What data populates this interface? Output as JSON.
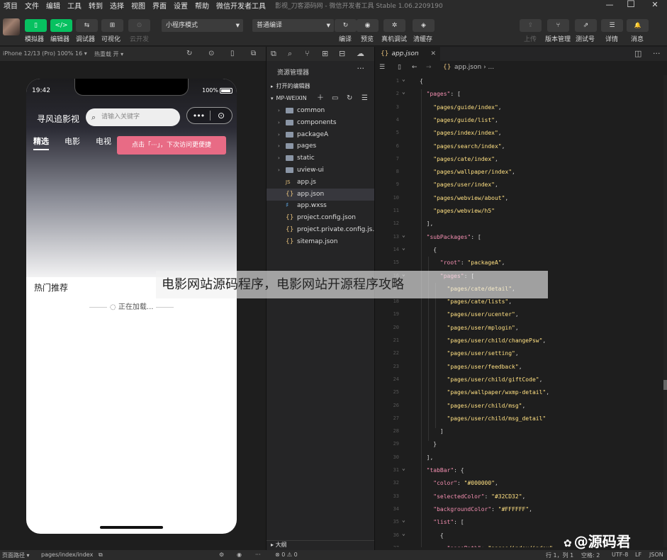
{
  "menu": {
    "items": [
      "项目",
      "文件",
      "编辑",
      "工具",
      "转到",
      "选择",
      "视图",
      "界面",
      "设置",
      "帮助",
      "微信开发者工具"
    ],
    "window_title": "影视_刀客源码网 - 微信开发者工具 Stable 1.06.2209190",
    "min": "—",
    "max": "☐",
    "close": "✕"
  },
  "toolbar": {
    "simulator": "模拟器",
    "editor": "编辑器",
    "debugger": "调试器",
    "visual": "可视化",
    "cloud": "云开发",
    "mode_select": "小程序模式",
    "compile_select": "普通编译",
    "compile": "编译",
    "preview": "预览",
    "real_debug": "真机调试",
    "clear_cache": "清缓存",
    "upload": "上传",
    "version": "版本管理",
    "test": "测试号",
    "details": "详情",
    "messages": "消息",
    "icons": {
      "simulator": "▯",
      "editor": "</>",
      "debugger": "⇆",
      "visual": "⊞",
      "cloud": "⊙",
      "compile": "↻",
      "preview": "◉",
      "real_debug": "✲",
      "clear_cache": "◈",
      "upload": "⇪",
      "version": "⑂",
      "test": "⇗",
      "details": "☰",
      "messages": "🔔"
    }
  },
  "simulator": {
    "device": "iPhone 12/13 (Pro) 100% 16 ▾",
    "hot_reload": "热重载 开 ▾",
    "status_time": "19:42",
    "battery": "100%",
    "app_name": "寻风追影视",
    "search_placeholder": "请输入关键字",
    "capsule_dots": "•••",
    "capsule_target": "⊙",
    "tabs": [
      "精选",
      "电影",
      "电视"
    ],
    "tooltip": "点击「···」，下次访问更便捷",
    "hot_title": "热门推荐",
    "loading": "正在加载..."
  },
  "explorer": {
    "title": "资源管理器",
    "more": "···",
    "open_editors": "打开的编辑器",
    "project": "MP-WEIXIN",
    "items": [
      {
        "name": "common",
        "type": "folder",
        "arrow": "›"
      },
      {
        "name": "components",
        "type": "folder",
        "arrow": "›"
      },
      {
        "name": "packageA",
        "type": "folder",
        "arrow": "›"
      },
      {
        "name": "pages",
        "type": "folder",
        "arrow": "›"
      },
      {
        "name": "static",
        "type": "folder",
        "arrow": "›"
      },
      {
        "name": "uview-ui",
        "type": "folder",
        "arrow": "›"
      },
      {
        "name": "app.js",
        "type": "js",
        "arrow": ""
      },
      {
        "name": "app.json",
        "type": "json",
        "arrow": ""
      },
      {
        "name": "app.wxss",
        "type": "css",
        "arrow": ""
      },
      {
        "name": "project.config.json",
        "type": "json",
        "arrow": ""
      },
      {
        "name": "project.private.config.js...",
        "type": "json",
        "arrow": ""
      },
      {
        "name": "sitemap.json",
        "type": "json",
        "arrow": ""
      }
    ],
    "outline": "大纲"
  },
  "editor": {
    "tab": "app.json",
    "breadcrumb": "app.json › ...",
    "lines": [
      {
        "n": "1",
        "t": "{"
      },
      {
        "n": "2",
        "t": "  \"pages\": ["
      },
      {
        "n": "3",
        "t": "    \"pages/guide/index\","
      },
      {
        "n": "4",
        "t": "    \"pages/guide/list\","
      },
      {
        "n": "5",
        "t": "    \"pages/index/index\","
      },
      {
        "n": "6",
        "t": "    \"pages/search/index\","
      },
      {
        "n": "7",
        "t": "    \"pages/cate/index\","
      },
      {
        "n": "8",
        "t": "    \"pages/wallpaper/index\","
      },
      {
        "n": "9",
        "t": "    \"pages/user/index\","
      },
      {
        "n": "10",
        "t": "    \"pages/webview/about\","
      },
      {
        "n": "11",
        "t": "    \"pages/webview/h5\""
      },
      {
        "n": "12",
        "t": "  ],"
      },
      {
        "n": "13",
        "t": "  \"subPackages\": ["
      },
      {
        "n": "14",
        "t": "    {"
      },
      {
        "n": "15",
        "t": "      \"root\": \"packageA\","
      },
      {
        "n": "16",
        "t": "      \"pages\": ["
      },
      {
        "n": "17",
        "t": "        \"pages/cate/detail\","
      },
      {
        "n": "18",
        "t": "        \"pages/cate/lists\","
      },
      {
        "n": "19",
        "t": "        \"pages/user/ucenter\","
      },
      {
        "n": "20",
        "t": "        \"pages/user/mplogin\","
      },
      {
        "n": "21",
        "t": "        \"pages/user/child/changePsw\","
      },
      {
        "n": "22",
        "t": "        \"pages/user/setting\","
      },
      {
        "n": "23",
        "t": "        \"pages/user/feedback\","
      },
      {
        "n": "24",
        "t": "        \"pages/user/child/giftCode\","
      },
      {
        "n": "25",
        "t": "        \"pages/wallpaper/wxmp-detail\","
      },
      {
        "n": "26",
        "t": "        \"pages/user/child/msg\","
      },
      {
        "n": "27",
        "t": "        \"pages/user/child/msg_detail\""
      },
      {
        "n": "28",
        "t": "      ]"
      },
      {
        "n": "29",
        "t": "    }"
      },
      {
        "n": "30",
        "t": "  ],"
      },
      {
        "n": "31",
        "t": "  \"tabBar\": {"
      },
      {
        "n": "32",
        "t": "    \"color\": \"#000000\","
      },
      {
        "n": "33",
        "t": "    \"selectedColor\": \"#32CD32\","
      },
      {
        "n": "34",
        "t": "    \"backgroundColor\": \"#FFFFFF\","
      },
      {
        "n": "35",
        "t": "    \"list\": ["
      },
      {
        "n": "36",
        "t": "      {"
      },
      {
        "n": "37",
        "t": "        \"pagePath\": \"pages/index/index\","
      }
    ]
  },
  "statusbar": {
    "page_path_label": "页面路径 ▾",
    "page_path": "pages/index/index",
    "problems": "⊗ 0 ⚠ 0",
    "position": "行 1，列 1",
    "spaces": "空格: 2",
    "encoding": "UTF-8",
    "eol": "LF",
    "lang": "JSON"
  },
  "overlay_caption": "电影网站源码程序，电影网站开源程序攻略",
  "watermark": "@源码君",
  "colors": {
    "accent": "#07c160",
    "tooltip": "#e86b85",
    "key": "#f48fb1",
    "string": "#ffe082"
  }
}
